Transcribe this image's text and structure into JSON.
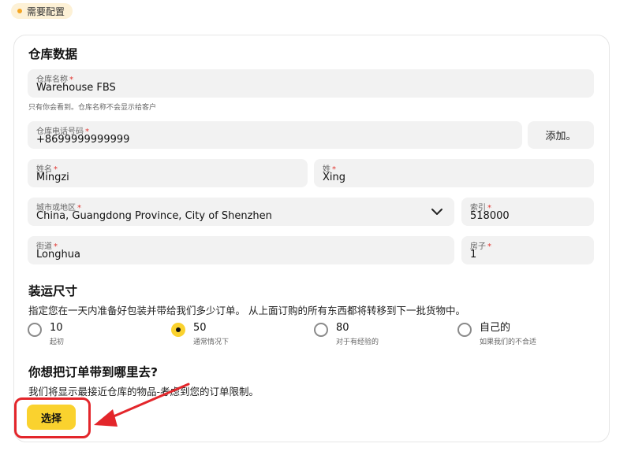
{
  "status_badge": {
    "text": "需要配置",
    "color": "#f5a623"
  },
  "warehouse": {
    "title": "仓库数据",
    "name": {
      "label": "仓库名称",
      "value": "Warehouse FBS",
      "hint": "只有你会看到。仓库名称不会显示给客户"
    },
    "phone": {
      "label": "仓库电话号码",
      "value": "+8699999999999",
      "add_label": "添加。"
    },
    "first_name": {
      "label": "姓名",
      "value": "Mingzi"
    },
    "last_name": {
      "label": "姓",
      "value": "Xing"
    },
    "city": {
      "label": "城市或地区",
      "value": "China, Guangdong Province, City of Shenzhen",
      "icon": "chevron-down-icon"
    },
    "postcode": {
      "label": "索引",
      "value": "518000"
    },
    "street": {
      "label": "街道",
      "value": "Longhua"
    },
    "house": {
      "label": "房子",
      "value": "1"
    },
    "required_mark": "*"
  },
  "shipment": {
    "title": "装运尺寸",
    "description": "指定您在一天内准备好包装并带给我们多少订单。 从上面订购的所有东西都将转移到下一批货物中。",
    "options": [
      {
        "label": "10",
        "sub": "起初",
        "selected": false
      },
      {
        "label": "50",
        "sub": "通常情况下",
        "selected": true
      },
      {
        "label": "80",
        "sub": "对于有经验的",
        "selected": false
      },
      {
        "label": "自己的",
        "sub": "如果我们的不合适",
        "selected": false
      }
    ]
  },
  "destination": {
    "title": "你想把订单带到哪里去?",
    "description": "我们将显示最接近仓库的物品-考虑到您的订单限制。",
    "select_label": "选择"
  },
  "colors": {
    "accent": "#fad22e",
    "annotation": "#e3262b"
  }
}
